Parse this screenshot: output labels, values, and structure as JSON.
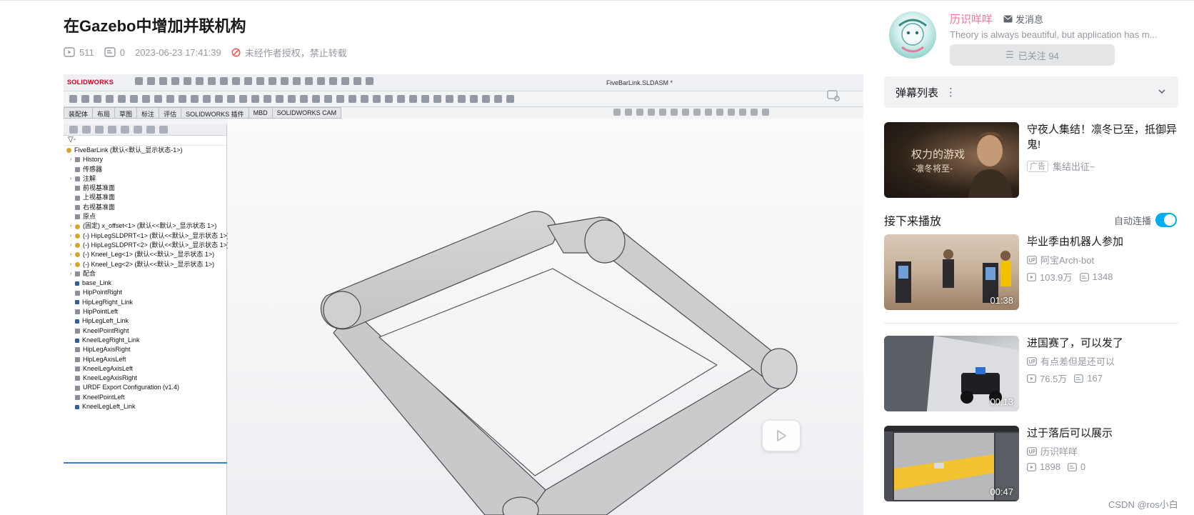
{
  "video": {
    "title": "在Gazebo中增加并联机构",
    "views": "511",
    "danmaku_count": "0",
    "publish_time": "2023-06-23 17:41:39",
    "copyright_notice": "未经作者授权，禁止转载"
  },
  "solidworks": {
    "logo": "SOLIDWORKS",
    "filename": "FiveBarLink.SLDASM *",
    "tabs": [
      "装配体",
      "布局",
      "草图",
      "标注",
      "评估",
      "SOLIDWORKS 插件",
      "MBD",
      "SOLIDWORKS CAM"
    ],
    "filter_label": "▽-",
    "tree": [
      {
        "label": "FiveBarLink  (默认<默认_显示状态-1>)",
        "indent": 0,
        "icon": "y",
        "expand": false
      },
      {
        "label": "History",
        "indent": 1,
        "icon": "g",
        "expand": true
      },
      {
        "label": "传感器",
        "indent": 1,
        "icon": "g",
        "expand": false
      },
      {
        "label": "注解",
        "indent": 1,
        "icon": "g",
        "expand": true
      },
      {
        "label": "前视基准面",
        "indent": 1,
        "icon": "g",
        "expand": false
      },
      {
        "label": "上视基准面",
        "indent": 1,
        "icon": "g",
        "expand": false
      },
      {
        "label": "右视基准面",
        "indent": 1,
        "icon": "g",
        "expand": false
      },
      {
        "label": "原点",
        "indent": 1,
        "icon": "g",
        "expand": false
      },
      {
        "label": "(固定) x_offset<1> (默认<<默认>_显示状态 1>)",
        "indent": 1,
        "icon": "y",
        "expand": true
      },
      {
        "label": "(-) HipLegSLDPRT<1> (默认<<默认>_显示状态 1>)",
        "indent": 1,
        "icon": "y",
        "expand": true
      },
      {
        "label": "(-) HipLegSLDPRT<2> (默认<<默认>_显示状态 1>)",
        "indent": 1,
        "icon": "y",
        "expand": true
      },
      {
        "label": "(-) Kneel_Leg<1> (默认<<默认>_显示状态 1>)",
        "indent": 1,
        "icon": "y",
        "expand": true
      },
      {
        "label": "(-) Kneel_Leg<2> (默认<<默认>_显示状态 1>)",
        "indent": 1,
        "icon": "y",
        "expand": true
      },
      {
        "label": "配合",
        "indent": 1,
        "icon": "g",
        "expand": true
      },
      {
        "label": "base_Link",
        "indent": 1,
        "icon": "l",
        "expand": false
      },
      {
        "label": "HipPointRight",
        "indent": 1,
        "icon": "g",
        "expand": false
      },
      {
        "label": "HipLegRight_Link",
        "indent": 1,
        "icon": "l",
        "expand": false
      },
      {
        "label": "HipPointLeft",
        "indent": 1,
        "icon": "g",
        "expand": false
      },
      {
        "label": "HipLegLeft_Link",
        "indent": 1,
        "icon": "l",
        "expand": false
      },
      {
        "label": "KneelPointRight",
        "indent": 1,
        "icon": "g",
        "expand": false
      },
      {
        "label": "KneelLegRight_Link",
        "indent": 1,
        "icon": "l",
        "expand": false
      },
      {
        "label": "HipLegAxisRight",
        "indent": 1,
        "icon": "g",
        "expand": false
      },
      {
        "label": "HipLegAxisLeft",
        "indent": 1,
        "icon": "g",
        "expand": false
      },
      {
        "label": "KneelLegAxisLeft",
        "indent": 1,
        "icon": "g",
        "expand": false
      },
      {
        "label": "KneelLegAxisRight",
        "indent": 1,
        "icon": "g",
        "expand": false
      },
      {
        "label": "URDF Export Configuration (v1.4)",
        "indent": 1,
        "icon": "g",
        "expand": false
      },
      {
        "label": "KneelPointLeft",
        "indent": 1,
        "icon": "g",
        "expand": false
      },
      {
        "label": "KneelLegLeft_Link",
        "indent": 1,
        "icon": "l",
        "expand": false
      }
    ]
  },
  "uploader": {
    "name": "历识咩咩",
    "message_label": "发消息",
    "description": "Theory is always beautiful, but application has m...",
    "follow_label": "已关注 94"
  },
  "danmaku_panel": {
    "label": "弹幕列表"
  },
  "ad": {
    "title": "守夜人集结！凛冬已至，抵御异鬼!",
    "badge": "广告",
    "subtitle": "集结出征~",
    "thumb_text_1": "权力的游戏",
    "thumb_text_2": "-凛冬将至-"
  },
  "next_up": {
    "heading": "接下来播放",
    "autoplay_label": "自动连播",
    "autoplay_on": true
  },
  "recommendations": [
    {
      "title": "毕业季由机器人参加",
      "author": "阿宝Arch-bot",
      "views": "103.9万",
      "danmaku": "1348",
      "duration": "01:38"
    },
    {
      "title": "进国赛了，可以发了",
      "author": "有点差但是还可以",
      "views": "76.5万",
      "danmaku": "167",
      "duration": "00:13"
    },
    {
      "title": "过于落后可以展示",
      "author": "历识咩咩",
      "views": "1898",
      "danmaku": "0",
      "duration": "00:47"
    }
  ],
  "watermark": "CSDN @ros小白",
  "colors": {
    "accent": "#00aeec",
    "up_name": "#fb7299",
    "muted": "#9499a0"
  }
}
